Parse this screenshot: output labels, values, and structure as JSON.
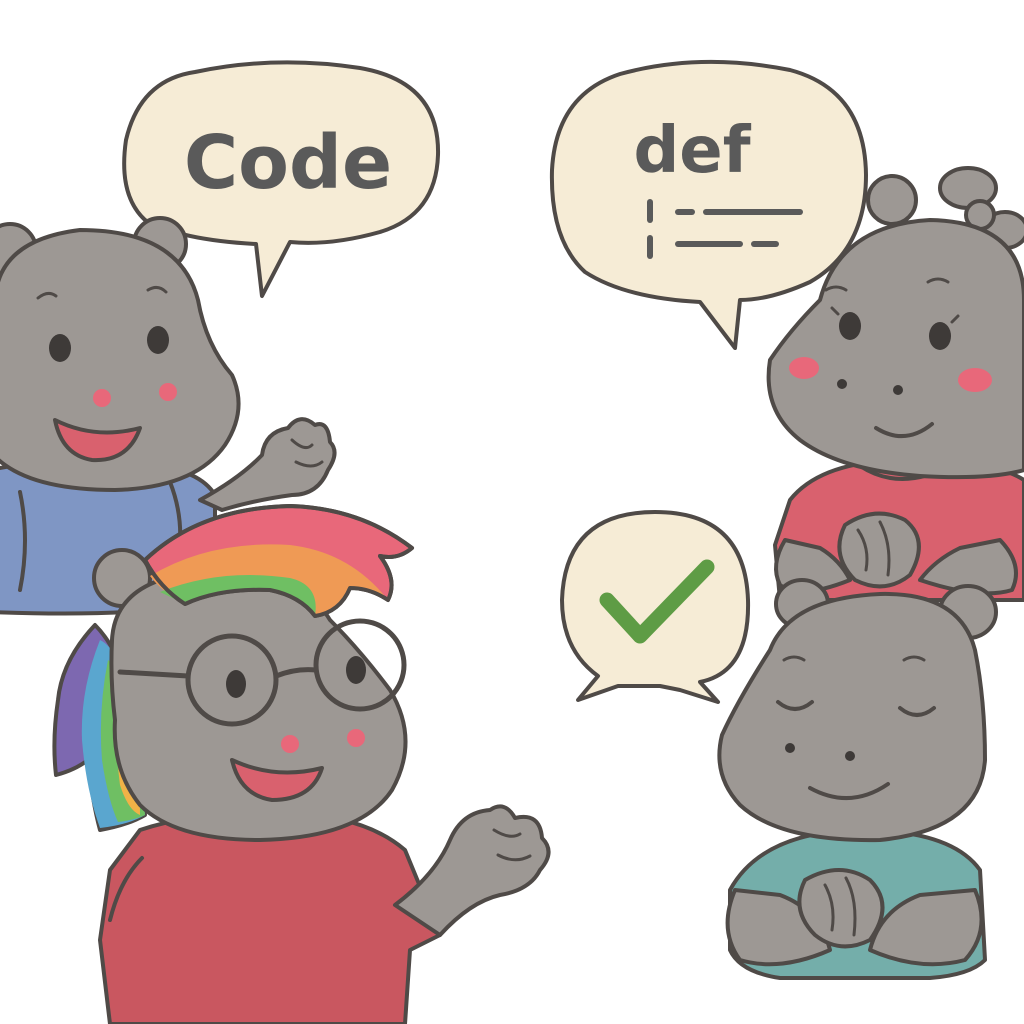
{
  "bubbles": {
    "left": {
      "text": "Code"
    },
    "right": {
      "text": "def"
    },
    "check": {
      "icon": "check-icon"
    }
  },
  "colors": {
    "outline": "#4f4a47",
    "skin": "#9d9894",
    "bubble_fill": "#f6ecd6",
    "check_green": "#5e9c45",
    "blush": "#e8687a",
    "shirt_blue": "#7f96c4",
    "shirt_pink": "#d9616e",
    "shirt_red": "#c95760",
    "shirt_teal": "#74aeaa"
  }
}
